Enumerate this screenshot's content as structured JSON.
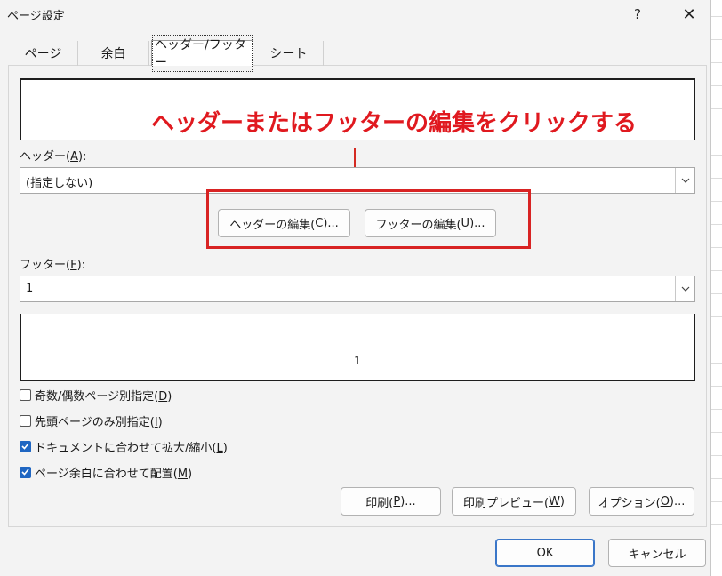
{
  "dialog": {
    "title": "ページ設定",
    "help_glyph": "?",
    "close_glyph": "✕"
  },
  "tabs": [
    "ページ",
    "余白",
    "ヘッダー/フッター",
    "シート"
  ],
  "annotation": "ヘッダーまたはフッターの編集をクリックする",
  "header": {
    "label_pre": "ヘッダー(",
    "label_key": "A",
    "label_post": "):",
    "value": "(指定しない)"
  },
  "edit_header": {
    "pre": "ヘッダーの編集(",
    "key": "C",
    "post": ")..."
  },
  "edit_footer": {
    "pre": "フッターの編集(",
    "key": "U",
    "post": ")..."
  },
  "footer": {
    "label_pre": "フッター(",
    "label_key": "F",
    "label_post": "):",
    "value": "1",
    "preview_text": "1"
  },
  "options": [
    {
      "pre": "奇数/偶数ページ別指定(",
      "key": "D",
      "post": ")",
      "checked": false
    },
    {
      "pre": "先頭ページのみ別指定(",
      "key": "I",
      "post": ")",
      "checked": false
    },
    {
      "pre": "ドキュメントに合わせて拡大/縮小(",
      "key": "L",
      "post": ")",
      "checked": true
    },
    {
      "pre": "ページ余白に合わせて配置(",
      "key": "M",
      "post": ")",
      "checked": true
    }
  ],
  "buttons": {
    "print": {
      "pre": "印刷(",
      "key": "P",
      "post": ")..."
    },
    "preview": {
      "pre": "印刷プレビュー(",
      "key": "W",
      "post": ")"
    },
    "options": {
      "pre": "オプション(",
      "key": "O",
      "post": ")..."
    },
    "ok": "OK",
    "cancel": "キャンセル"
  },
  "colors": {
    "annotation": "#e0191f",
    "checkbox_checked": "#1f66c2",
    "ok_border": "#3a76c8"
  }
}
